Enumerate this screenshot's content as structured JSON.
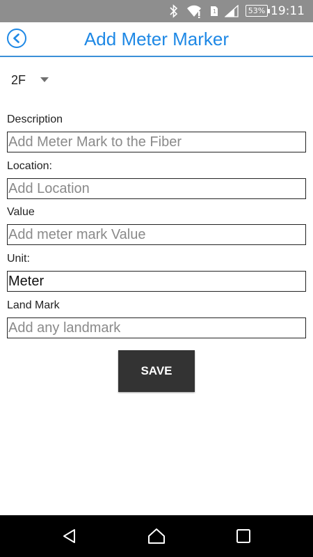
{
  "status_bar": {
    "time": "19:11",
    "battery": "53%",
    "icons": [
      "bluetooth-icon",
      "wifi-icon",
      "sim-icon",
      "signal-icon",
      "battery-icon"
    ]
  },
  "app_bar": {
    "title": "Add Meter Marker",
    "back_icon": "back-circle-icon",
    "accent_color": "#1e88e5"
  },
  "spinner": {
    "selected": "2F"
  },
  "form": {
    "description": {
      "label": "Description",
      "value": "",
      "placeholder": "Add Meter Mark to the Fiber"
    },
    "location": {
      "label": "Location:",
      "value": "",
      "placeholder": "Add Location"
    },
    "value": {
      "label": "Value",
      "value": "",
      "placeholder": "Add meter mark Value"
    },
    "unit": {
      "label": "Unit:",
      "value": "Meter",
      "placeholder": ""
    },
    "landmark": {
      "label": "Land Mark",
      "value": "",
      "placeholder": "Add any landmark"
    }
  },
  "save_label": "SAVE",
  "nav_bar": {
    "icons": [
      "back-triangle-icon",
      "home-icon",
      "recents-icon"
    ]
  }
}
